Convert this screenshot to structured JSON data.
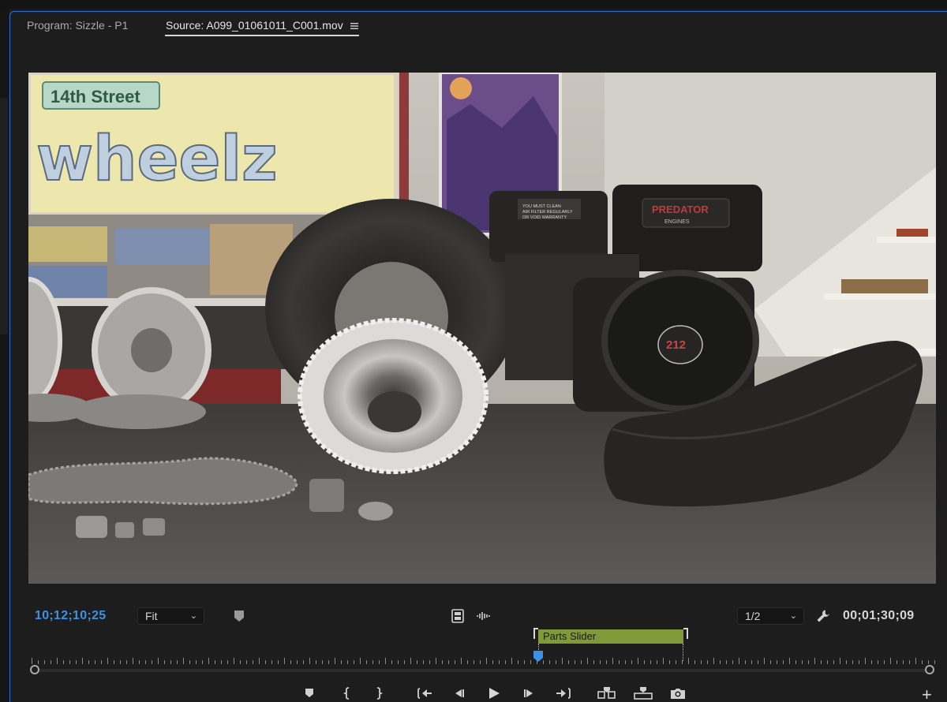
{
  "tabs": {
    "program": "Program: Sizzle - P1",
    "source": "Source: A099_01061011_C001.mov"
  },
  "video": {
    "sign_street": "14th Street",
    "sign_brand": "wheelz",
    "engine_brand": "PREDATOR",
    "engine_sub": "ENGINES",
    "engine_cc": "212",
    "engine_label_1": "YOU MUST CLEAN",
    "engine_label_2": "AIR FILTER REGULARLY",
    "engine_label_3": "OR VOID WARRANTY"
  },
  "controls": {
    "current_timecode": "10;12;10;25",
    "duration_timecode": "00;01;30;09",
    "zoom_value": "Fit",
    "resolution_value": "1/2",
    "clip_name": "Parts Slider",
    "playhead_position": 0.56,
    "in_point": 0.56,
    "out_point": 0.723
  },
  "icons": {
    "tab_menu": "hamburger-menu-icon",
    "marker": "marker-icon",
    "drag_video": "film-strip-icon",
    "drag_audio": "audio-waveform-icon",
    "settings": "wrench-icon"
  },
  "colors": {
    "accent_blue": "#3d8fe8",
    "clip_green": "#7f9a37",
    "panel_bg": "#1d1d1d"
  },
  "transport": [
    {
      "name": "add-marker-button",
      "icon": "marker-icon"
    },
    {
      "name": "mark-in-button",
      "icon": "mark-in-icon"
    },
    {
      "name": "mark-out-button",
      "icon": "mark-out-icon"
    },
    {
      "name": "go-to-in-button",
      "icon": "go-to-in-icon"
    },
    {
      "name": "step-back-button",
      "icon": "step-back-icon"
    },
    {
      "name": "play-button",
      "icon": "play-icon"
    },
    {
      "name": "step-forward-button",
      "icon": "step-forward-icon"
    },
    {
      "name": "go-to-out-button",
      "icon": "go-to-out-icon"
    },
    {
      "name": "insert-button",
      "icon": "insert-icon"
    },
    {
      "name": "overwrite-button",
      "icon": "overwrite-icon"
    },
    {
      "name": "export-frame-button",
      "icon": "camera-icon"
    }
  ]
}
